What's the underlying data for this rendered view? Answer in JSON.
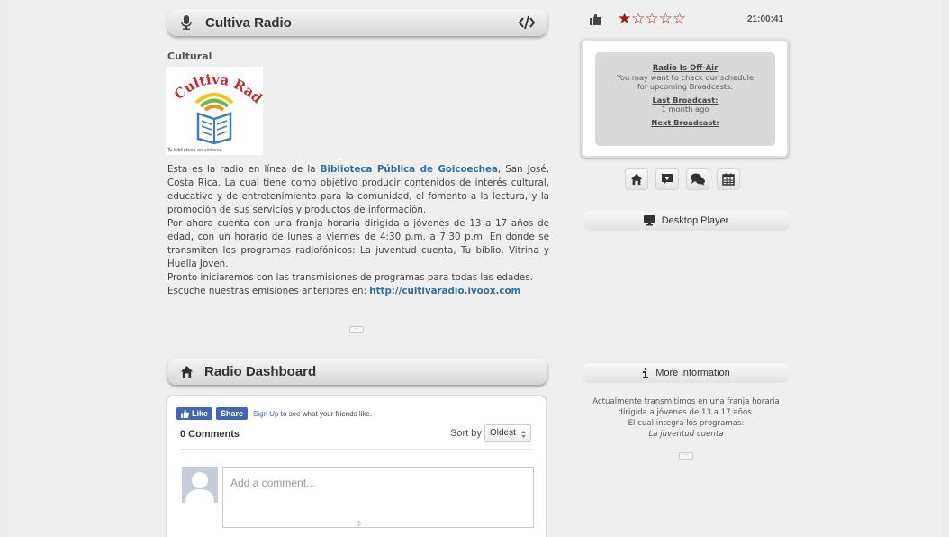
{
  "station": {
    "name": "Cultiva Radio",
    "genre": "Cultural",
    "logo_text": "Cultiva Radio",
    "logo_tagline": "Tu biblioteca en sintonía",
    "description": {
      "p1_before": "Esta es la radio en línea de la ",
      "p1_link": "Biblioteca Pública de Goicoechea",
      "p1_after": ", San José, Costa Rica. La cual tiene como objetivo producir contenidos de interés cultural, educativo y de entretenimiento para la comunidad, el fomento a la lectura, y la promoción de sus servicios y productos de información.",
      "p2": "Por ahora cuenta con una franja horaria dirigida a jóvenes de 13 a 17 años de edad, con un horario de lunes a viernes de 4:30 p.m. a 7:30 p.m. En donde se transmiten los programas radiofónicos: La juventud cuenta, Tu biblio, Vitrina y Huella Joven.",
      "p3": "Pronto iniciaremos con las transmisiones de programas para todas las edades.",
      "p4_before": "Escuche nuestras emisiones anteriores en: ",
      "p4_link": "http://cultivaradio.ivoox.com"
    },
    "more_dots": "···"
  },
  "dashboard": {
    "title": "Radio Dashboard"
  },
  "comments": {
    "like_label": "Like",
    "share_label": "Share",
    "signup_label": "Sign Up",
    "signup_suffix": " to see what your friends like.",
    "count_label": "0 Comments",
    "sort_label": "Sort by",
    "sort_value": "Oldest",
    "placeholder": "Add a comment..."
  },
  "rating": {
    "stars_filled": 1,
    "stars_total": 5,
    "filled_glyph": "★",
    "empty_glyph": "☆"
  },
  "clock": "21:00:41",
  "status": {
    "title": "Radio Is Off-Air",
    "message_line1": "You may want to check our schedule",
    "message_line2": "for upcoming Broadcasts.",
    "last_label": "Last Broadcast:",
    "last_value": "1 month ago",
    "next_label": "Next Broadcast:"
  },
  "actions": [
    "home-icon",
    "comment-icon",
    "chat-icon",
    "calendar-icon"
  ],
  "desktop_player_label": "Desktop Player",
  "more_info": {
    "label": "More information",
    "line1": "Actualmente transmitimos en una franja horaria",
    "line2": "dirigida a jóvenes de 13 a 17 años.",
    "line3": "El cual integra los programas:",
    "line4": "La juventud cuenta",
    "more_dots": "···"
  },
  "colors": {
    "accent_link": "#2a6fa8",
    "star": "#a01818",
    "facebook": "#4267b2"
  }
}
